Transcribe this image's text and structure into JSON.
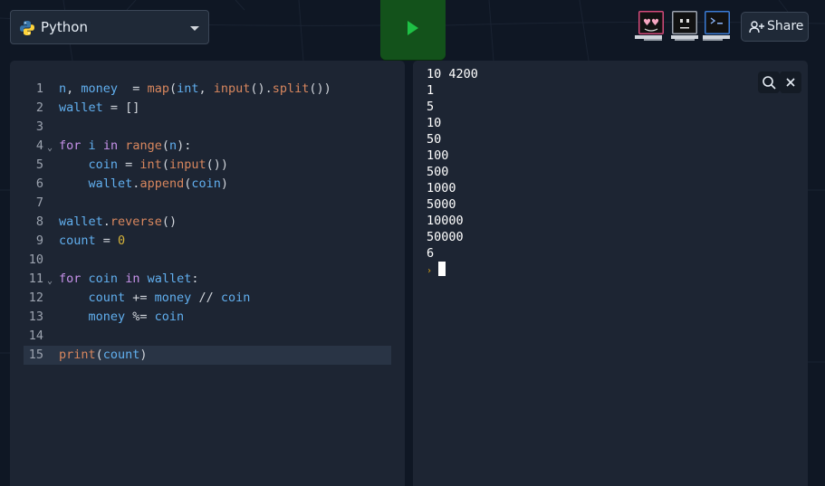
{
  "language_selector": {
    "label": "Python",
    "icon": "python-logo-icon"
  },
  "run_button": {
    "icon": "play-icon",
    "color": "#13521b"
  },
  "avatars": [
    {
      "name": "avatar-love-icon",
      "color": "#d44a7a"
    },
    {
      "name": "avatar-neutral-icon",
      "color": "#9ca3af"
    },
    {
      "name": "avatar-terminal-icon",
      "color": "#3a7bd5"
    }
  ],
  "share_button": {
    "label": "Share",
    "icon": "add-user-icon"
  },
  "editor": {
    "lines": [
      {
        "num": "1",
        "tokens": [
          [
            "v",
            "n"
          ],
          [
            "o",
            ", "
          ],
          [
            "v",
            "money"
          ],
          [
            "o",
            "  = "
          ],
          [
            "f",
            "map"
          ],
          [
            "o",
            "("
          ],
          [
            "v",
            "int"
          ],
          [
            "o",
            ", "
          ],
          [
            "f",
            "input"
          ],
          [
            "o",
            "()."
          ],
          [
            "f",
            "split"
          ],
          [
            "o",
            "())"
          ]
        ]
      },
      {
        "num": "2",
        "tokens": [
          [
            "v",
            "wallet"
          ],
          [
            "o",
            " = []"
          ]
        ]
      },
      {
        "num": "3",
        "tokens": []
      },
      {
        "num": "4",
        "fold": true,
        "tokens": [
          [
            "k",
            "for"
          ],
          [
            "o",
            " "
          ],
          [
            "v",
            "i"
          ],
          [
            "o",
            " "
          ],
          [
            "k",
            "in"
          ],
          [
            "o",
            " "
          ],
          [
            "f",
            "range"
          ],
          [
            "o",
            "("
          ],
          [
            "v",
            "n"
          ],
          [
            "o",
            "):"
          ]
        ]
      },
      {
        "num": "5",
        "tokens": [
          [
            "o",
            "    "
          ],
          [
            "v",
            "coin"
          ],
          [
            "o",
            " = "
          ],
          [
            "f",
            "int"
          ],
          [
            "o",
            "("
          ],
          [
            "f",
            "input"
          ],
          [
            "o",
            "())"
          ]
        ]
      },
      {
        "num": "6",
        "tokens": [
          [
            "o",
            "    "
          ],
          [
            "v",
            "wallet"
          ],
          [
            "o",
            "."
          ],
          [
            "f",
            "append"
          ],
          [
            "o",
            "("
          ],
          [
            "v",
            "coin"
          ],
          [
            "o",
            ")"
          ]
        ]
      },
      {
        "num": "7",
        "tokens": []
      },
      {
        "num": "8",
        "tokens": [
          [
            "v",
            "wallet"
          ],
          [
            "o",
            "."
          ],
          [
            "f",
            "reverse"
          ],
          [
            "o",
            "()"
          ]
        ]
      },
      {
        "num": "9",
        "tokens": [
          [
            "v",
            "count"
          ],
          [
            "o",
            " = "
          ],
          [
            "n",
            "0"
          ]
        ]
      },
      {
        "num": "10",
        "tokens": []
      },
      {
        "num": "11",
        "fold": true,
        "tokens": [
          [
            "k",
            "for"
          ],
          [
            "o",
            " "
          ],
          [
            "v",
            "coin"
          ],
          [
            "o",
            " "
          ],
          [
            "k",
            "in"
          ],
          [
            "o",
            " "
          ],
          [
            "v",
            "wallet"
          ],
          [
            "o",
            ":"
          ]
        ]
      },
      {
        "num": "12",
        "tokens": [
          [
            "o",
            "    "
          ],
          [
            "v",
            "count"
          ],
          [
            "o",
            " += "
          ],
          [
            "v",
            "money"
          ],
          [
            "o",
            " // "
          ],
          [
            "v",
            "coin"
          ]
        ]
      },
      {
        "num": "13",
        "tokens": [
          [
            "o",
            "    "
          ],
          [
            "v",
            "money"
          ],
          [
            "o",
            " %= "
          ],
          [
            "v",
            "coin"
          ]
        ]
      },
      {
        "num": "14",
        "tokens": []
      },
      {
        "num": "15",
        "active": true,
        "tokens": [
          [
            "f",
            "print"
          ],
          [
            "o",
            "("
          ],
          [
            "v",
            "count"
          ],
          [
            "o",
            ")"
          ]
        ]
      }
    ]
  },
  "console": {
    "output": [
      "10 4200",
      "1",
      "5",
      "10",
      "50",
      "100",
      "500",
      "1000",
      "5000",
      "10000",
      "50000",
      "6"
    ],
    "prompt": "›",
    "search_icon": "search-icon",
    "close_icon": "close-icon"
  }
}
